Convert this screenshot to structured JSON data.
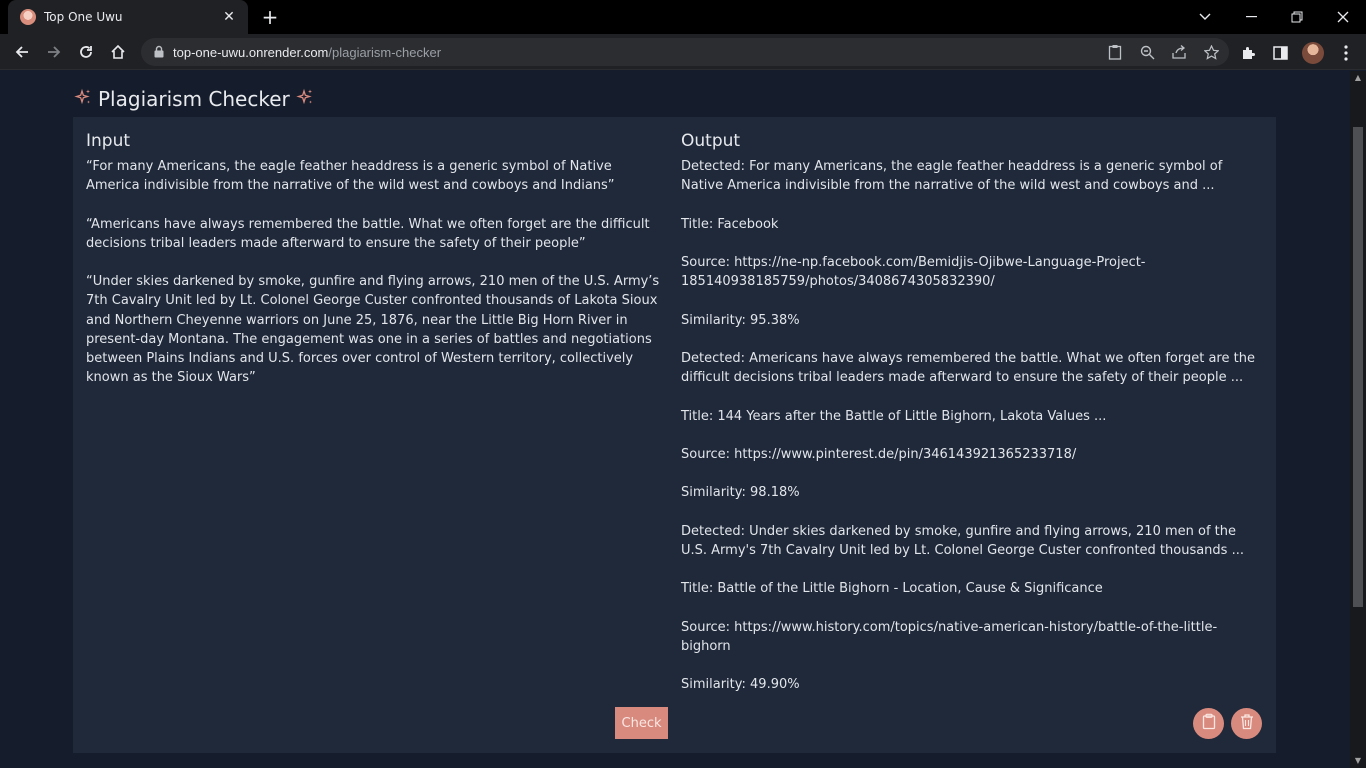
{
  "browser": {
    "tab_title": "Top One Uwu",
    "url_domain": "top-one-uwu.onrender.com",
    "url_path": "/plagiarism-checker"
  },
  "page": {
    "title": "Plagiarism Checker",
    "input": {
      "heading": "Input",
      "text": "“For many Americans, the eagle feather headdress is a generic symbol of Native America indivisible from the narrative of the wild west and cowboys and Indians”\n\n“Americans have always remembered the battle. What we often forget are the difficult decisions tribal leaders made afterward to ensure the safety of their people”\n\n“Under skies darkened by smoke, gunfire and flying arrows, 210 men of the U.S. Army’s 7th Cavalry Unit led by Lt. Colonel George Custer confronted thousands of Lakota Sioux and Northern Cheyenne warriors on June 25, 1876, near the Little Big Horn River in present-day Montana. The engagement was one in a series of battles and negotiations between Plains Indians and U.S. forces over control of Western territory, collectively known as the Sioux Wars”"
    },
    "output": {
      "heading": "Output",
      "text": "Detected: For many Americans, the eagle feather headdress is a generic symbol of Native America indivisible from the narrative of the wild west and cowboys and ...\n\nTitle: Facebook\n\nSource: https://ne-np.facebook.com/Bemidjis-Ojibwe-Language-Project-185140938185759/photos/3408674305832390/\n\nSimilarity: 95.38%\n\nDetected: Americans have always remembered the battle. What we often forget are the difficult decisions tribal leaders made afterward to ensure the safety of their people ...\n\nTitle: 144 Years after the Battle of Little Bighorn, Lakota Values ...\n\nSource: https://www.pinterest.de/pin/346143921365233718/\n\nSimilarity: 98.18%\n\nDetected: Under skies darkened by smoke, gunfire and flying arrows, 210 men of the U.S. Army's 7th Cavalry Unit led by Lt. Colonel George Custer confronted thousands ...\n\nTitle: Battle of the Little Bighorn - Location, Cause & Significance\n\nSource: https://www.history.com/topics/native-american-history/battle-of-the-little-bighorn\n\nSimilarity: 49.90%"
    },
    "check_label": "Check"
  },
  "colors": {
    "accent": "#d98a7e",
    "background": "#151d2c",
    "card": "#1f293a"
  }
}
